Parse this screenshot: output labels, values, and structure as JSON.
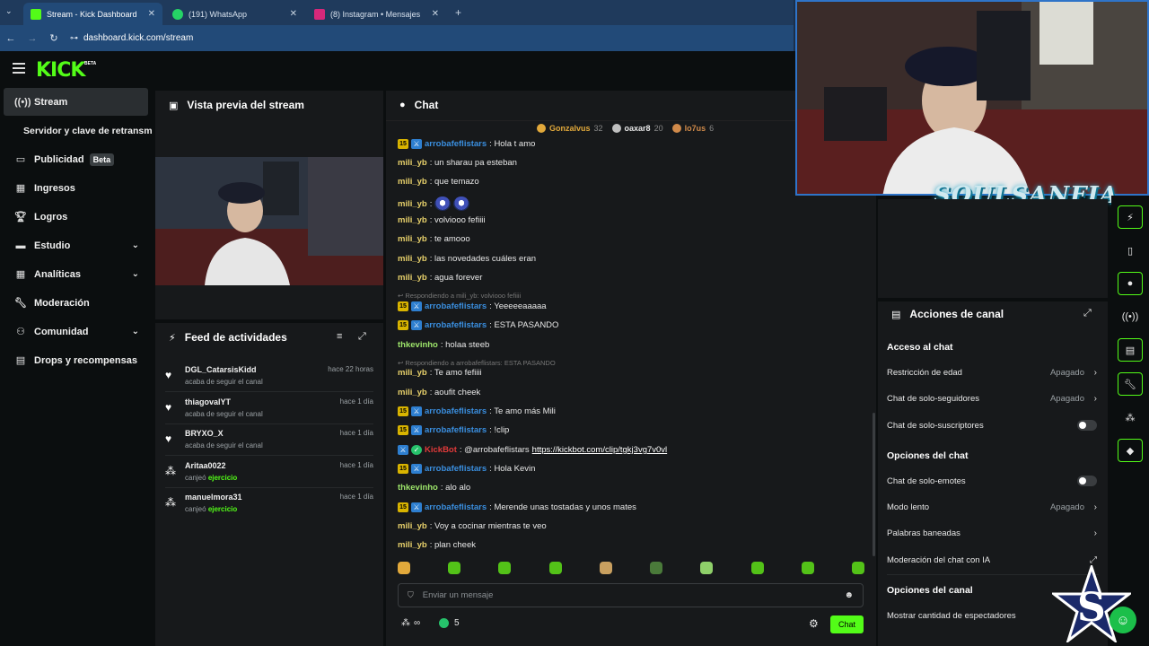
{
  "browser": {
    "tabs": [
      {
        "title": "Stream - Kick Dashboard",
        "color": "#53fc18"
      },
      {
        "title": "(191) WhatsApp",
        "color": "#25d366"
      },
      {
        "title": "(8) Instagram • Mensajes",
        "color": "#d6287a"
      }
    ],
    "url": "dashboard.kick.com/stream"
  },
  "header": {
    "logo": "KICK",
    "beta": "BETA"
  },
  "sidebar": {
    "items": [
      {
        "label": "Stream",
        "icon": "stream-icon"
      },
      {
        "label": "Servidor y clave de retransm",
        "icon": ""
      },
      {
        "label": "Publicidad",
        "icon": "ad-icon",
        "badge": "Beta"
      },
      {
        "label": "Ingresos",
        "icon": "revenue-icon"
      },
      {
        "label": "Logros",
        "icon": "trophy-icon"
      },
      {
        "label": "Estudio",
        "icon": "studio-icon"
      },
      {
        "label": "Analíticas",
        "icon": "analytics-icon"
      },
      {
        "label": "Moderación",
        "icon": "wrench-icon"
      },
      {
        "label": "Comunidad",
        "icon": "community-icon"
      },
      {
        "label": "Drops y recompensas",
        "icon": "drops-icon"
      }
    ]
  },
  "preview": {
    "title": "Vista previa del stream"
  },
  "feed": {
    "title": "Feed de actividades",
    "items": [
      {
        "name": "DGL_CatarsisKidd",
        "desc": "acaba de seguir el canal",
        "time": "hace 22 horas",
        "icon": "heart-icon"
      },
      {
        "name": "thiagovalYT",
        "desc": "acaba de seguir el canal",
        "time": "hace 1 día",
        "icon": "heart-icon"
      },
      {
        "name": "BRYXO_X",
        "desc": "acaba de seguir el canal",
        "time": "hace 1 día",
        "icon": "heart-icon"
      },
      {
        "name": "Aritaa0022",
        "desc": "canjeó",
        "reward": "ejercicio",
        "time": "hace 1 día",
        "icon": "points-icon"
      },
      {
        "name": "manuelmora31",
        "desc": "canjeó",
        "reward": "ejercicio",
        "time": "hace 1 día",
        "icon": "points-icon"
      }
    ]
  },
  "chat": {
    "title": "Chat",
    "leaderboard": [
      {
        "name": "Gonzalvus",
        "count": "32",
        "color": "#e2a93b"
      },
      {
        "name": "oaxar8",
        "count": "20",
        "color": "#c0c0c0"
      },
      {
        "name": "lo7us",
        "count": "6",
        "color": "#d08a4a"
      }
    ],
    "messages": [
      {
        "user": "arrobafeflistars",
        "text": ": Hola t amo",
        "color": "#3a8fe0",
        "badges": true
      },
      {
        "user": "mili_yb",
        "text": ": un sharau pa esteban",
        "color": "#e8d16b"
      },
      {
        "user": "mili_yb",
        "text": ": que temazo",
        "color": "#e8d16b"
      },
      {
        "user": "mili_yb",
        "text": ":",
        "color": "#e8d16b",
        "emotes": 2
      },
      {
        "user": "mili_yb",
        "text": ": volviooo fefiiii",
        "color": "#e8d16b"
      },
      {
        "user": "mili_yb",
        "text": ": te amooo",
        "color": "#e8d16b"
      },
      {
        "user": "mili_yb",
        "text": ": las novedades cuáles eran",
        "color": "#e8d16b"
      },
      {
        "user": "mili_yb",
        "text": ": agua forever",
        "color": "#e8d16b"
      },
      {
        "reply": "Respondiendo a mili_yb: volviooo fefiiii"
      },
      {
        "user": "arrobafeflistars",
        "text": ": Yeeeeeaaaaa",
        "color": "#3a8fe0",
        "badges": true
      },
      {
        "user": "arrobafeflistars",
        "text": ": ESTA PASANDO",
        "color": "#3a8fe0",
        "badges": true
      },
      {
        "user": "thkevinho",
        "text": ": holaa steeb",
        "color": "#9ee66b"
      },
      {
        "reply": "Respondiendo a arrobafeflistars: ESTA PASANDO"
      },
      {
        "user": "mili_yb",
        "text": ": Te amo fefiiii",
        "color": "#e8d16b"
      },
      {
        "user": "mili_yb",
        "text": ": aoufit cheek",
        "color": "#e8d16b"
      },
      {
        "user": "arrobafeflistars",
        "text": ": Te amo más Mili",
        "color": "#3a8fe0",
        "badges": true
      },
      {
        "user": "arrobafeflistars",
        "text": ": !clip",
        "color": "#3a8fe0",
        "badges": true
      },
      {
        "user": "KickBot",
        "text": ": @arrobafeflistars",
        "link": "https://kickbot.com/clip/tgkj3vg7v0vl",
        "color": "#e03a3a",
        "bot": true
      },
      {
        "user": "arrobafeflistars",
        "text": ": Hola Kevin",
        "color": "#3a8fe0",
        "badges": true
      },
      {
        "user": "thkevinho",
        "text": ": alo alo",
        "color": "#9ee66b"
      },
      {
        "user": "arrobafeflistars",
        "text": ": Merende unas tostadas y unos mates",
        "color": "#3a8fe0",
        "badges": true
      },
      {
        "user": "mili_yb",
        "text": ": Voy a cocinar mientras te veo",
        "color": "#e8d16b"
      },
      {
        "user": "mili_yb",
        "text": ": plan cheek",
        "color": "#e8d16b"
      }
    ],
    "sub_badge": "15",
    "input_placeholder": "Enviar un mensaje",
    "points": "∞",
    "kick_count": "5",
    "send_label": "Chat"
  },
  "actions": {
    "title": "Acciones de canal",
    "sections": [
      {
        "title": "Acceso al chat",
        "rows": [
          {
            "label": "Restricción de edad",
            "value": "Apagado",
            "type": "arrow"
          },
          {
            "label": "Chat de solo-seguidores",
            "value": "Apagado",
            "type": "arrow"
          },
          {
            "label": "Chat de solo-suscriptores",
            "type": "toggle"
          }
        ]
      },
      {
        "title": "Opciones del chat",
        "rows": [
          {
            "label": "Chat de solo-emotes",
            "type": "toggle"
          },
          {
            "label": "Modo lento",
            "value": "Apagado",
            "type": "arrow"
          },
          {
            "label": "Palabras baneadas",
            "type": "arrow"
          },
          {
            "label": "Moderación del chat con IA",
            "type": "external"
          }
        ]
      },
      {
        "title": "Opciones del canal",
        "rows": [
          {
            "label": "Mostrar cantidad de espectadores",
            "type": "none"
          }
        ]
      }
    ]
  },
  "overlay": {
    "text": "SOULSANFIA"
  }
}
